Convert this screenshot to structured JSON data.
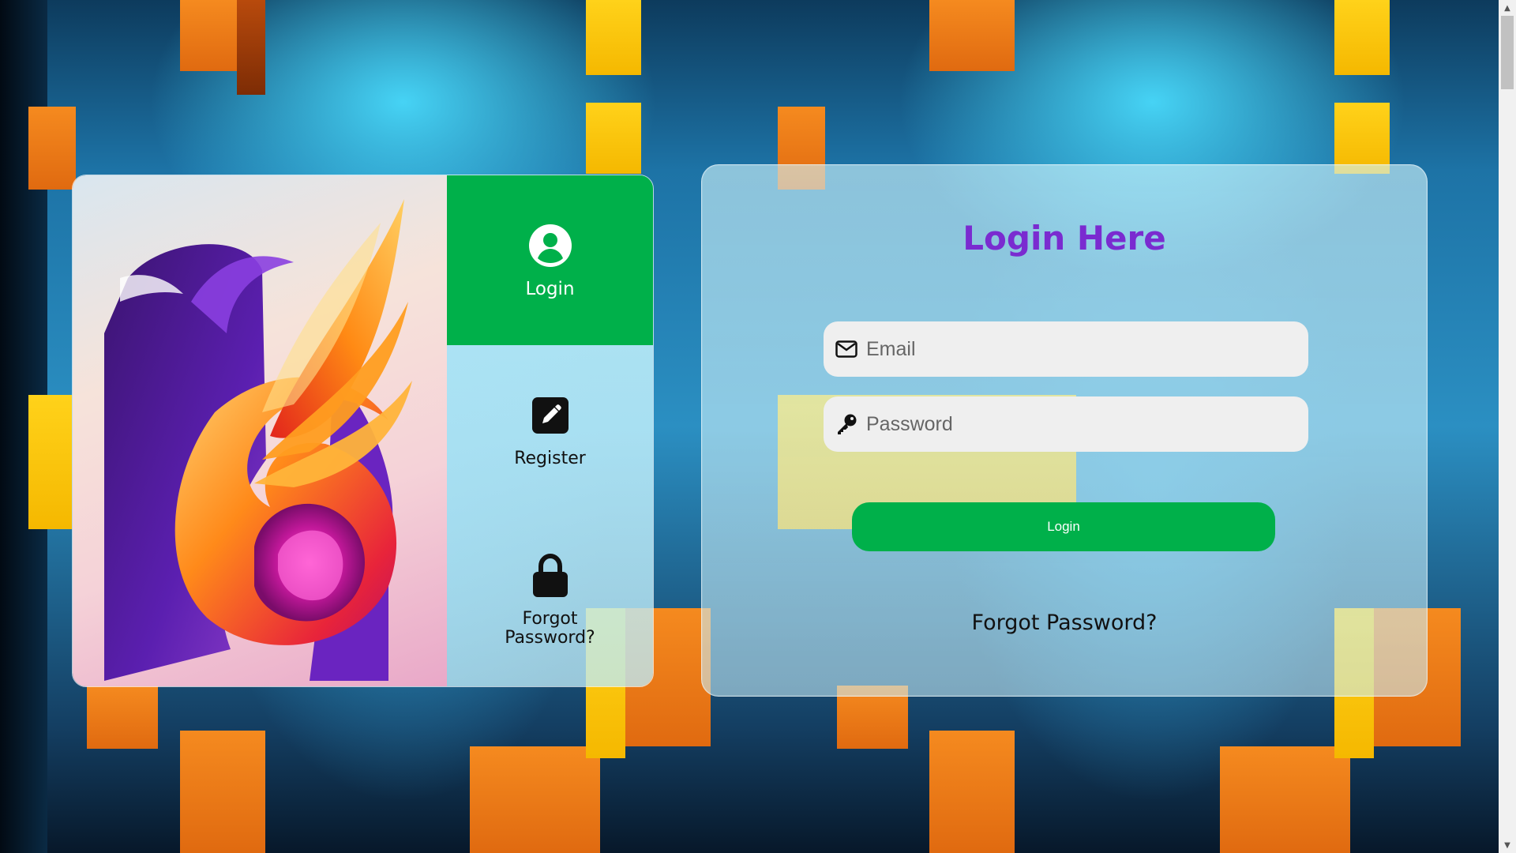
{
  "menu": {
    "items": [
      {
        "label": "Login",
        "icon": "user-circle-icon",
        "active": true
      },
      {
        "label": "Register",
        "icon": "edit-square-icon",
        "active": false
      },
      {
        "label": "Forgot Password?",
        "icon": "lock-icon",
        "active": false
      }
    ]
  },
  "login_form": {
    "title": "Login Here",
    "email_placeholder": "Email",
    "email_value": "",
    "password_placeholder": "Password",
    "password_value": "",
    "submit_label": "Login",
    "forgot_label": "Forgot Password?"
  },
  "colors": {
    "accent_green": "#00b04a",
    "title_purple": "#7a2bd0"
  }
}
